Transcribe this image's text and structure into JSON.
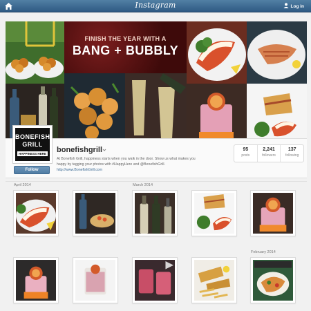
{
  "topbar": {
    "brand": "Instagram",
    "login_label": "Log in",
    "bg_color": "#3f6b94"
  },
  "banner": {
    "line1": "FINISH THE YEAR WITH A",
    "line2": "BANG + BUBBLY"
  },
  "profile": {
    "avatar_line1": "BONEFISH",
    "avatar_line2": "GRILL",
    "avatar_line3": "HAPPINESS HERE",
    "username": "bonefishgrill",
    "follow_label": "Follow",
    "bio_line1": "At Bonefish Grill, happiness starts when you walk in the door. Show us what makes you",
    "bio_line2": "happy by tagging your photos with #HappyHere and @BonefishGrill.",
    "website": "http://www.BonefishGrill.com",
    "stats": [
      {
        "value": "95",
        "label": "posts"
      },
      {
        "value": "2,241",
        "label": "followers"
      },
      {
        "value": "137",
        "label": "following"
      }
    ]
  },
  "months": {
    "april": "April 2014",
    "march": "March 2014",
    "february": "February 2014"
  },
  "thumbs": [
    {
      "subject": "lobster-tail"
    },
    {
      "subject": "beer-pasta"
    },
    {
      "subject": "wine-bottles"
    },
    {
      "subject": "sandwich-salad-lobster"
    },
    {
      "subject": "frozen-cocktail"
    },
    {
      "subject": "frozen-cocktail"
    },
    {
      "subject": "cocktail-glass"
    },
    {
      "subject": "pink-cocktails"
    },
    {
      "subject": "fried-fish-fries"
    },
    {
      "subject": "frozen-cocktail"
    },
    {
      "subject": "fish-tacos-photo"
    }
  ]
}
